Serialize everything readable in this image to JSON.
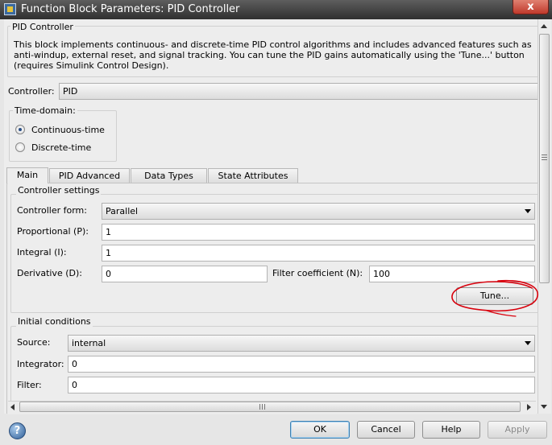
{
  "window": {
    "title": "Function Block Parameters: PID Controller",
    "close_label": "x"
  },
  "block": {
    "name": "PID Controller",
    "description": "This block implements continuous- and discrete-time PID control algorithms and includes advanced features such as anti-windup, external reset, and signal tracking. You can tune the PID gains automatically using the 'Tune...' button (requires Simulink Control Design)."
  },
  "controller": {
    "label": "Controller:",
    "value": "PID"
  },
  "time_domain": {
    "legend": "Time-domain:",
    "options": [
      {
        "label": "Continuous-time",
        "checked": true
      },
      {
        "label": "Discrete-time",
        "checked": false
      }
    ]
  },
  "tabs": [
    {
      "label": "Main",
      "active": true
    },
    {
      "label": "PID Advanced",
      "active": false
    },
    {
      "label": "Data Types",
      "active": false
    },
    {
      "label": "State Attributes",
      "active": false
    }
  ],
  "controller_settings": {
    "legend": "Controller settings",
    "form_label": "Controller form:",
    "form_value": "Parallel",
    "p_label": "Proportional (P):",
    "p_value": "1",
    "i_label": "Integral (I):",
    "i_value": "1",
    "d_label": "Derivative (D):",
    "d_value": "0",
    "n_label": "Filter coefficient (N):",
    "n_value": "100",
    "tune_label": "Tune..."
  },
  "initial_conditions": {
    "legend": "Initial conditions",
    "source_label": "Source:",
    "source_value": "internal",
    "integrator_label": "Integrator:",
    "integrator_value": "0",
    "filter_label": "Filter:",
    "filter_value": "0"
  },
  "buttons": {
    "help_icon": "?",
    "ok": "OK",
    "cancel": "Cancel",
    "help": "Help",
    "apply": "Apply"
  },
  "colors": {
    "annotation": "#d8000c",
    "titlebar": "#2f2f2f"
  }
}
